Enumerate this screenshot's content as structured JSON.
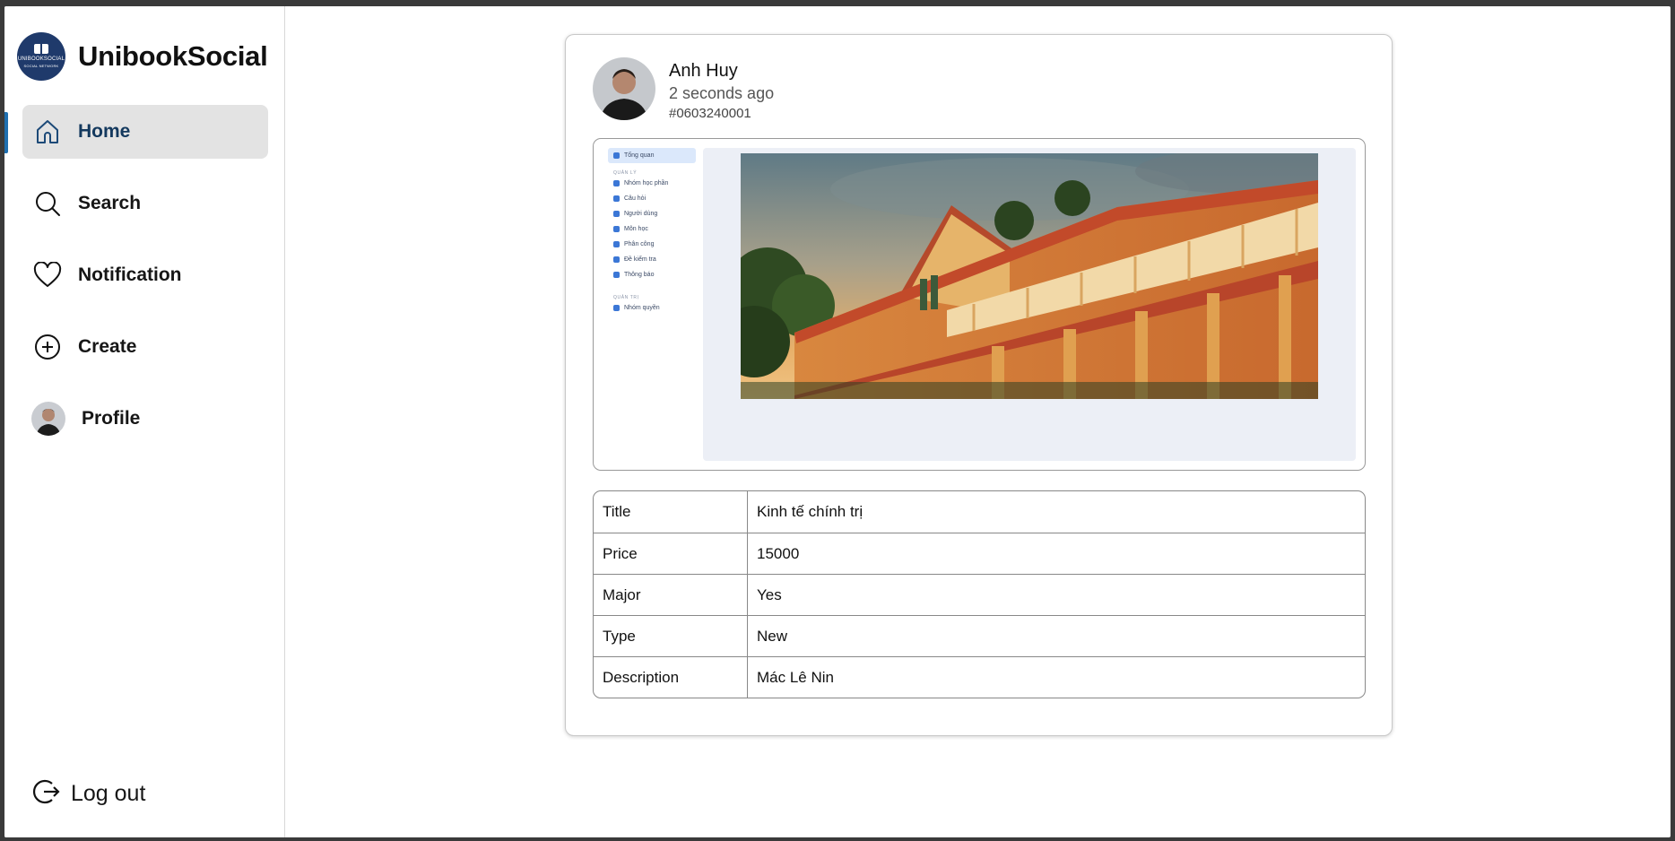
{
  "app": {
    "brand_name": "UnibookSocial",
    "logo_text": "UNIBOOKSOCIAL",
    "logo_subtext": "SOCIAL NETWORK"
  },
  "sidebar": {
    "items": [
      {
        "label": "Home",
        "icon": "home-icon",
        "active": true
      },
      {
        "label": "Search",
        "icon": "search-icon",
        "active": false
      },
      {
        "label": "Notification",
        "icon": "heart-icon",
        "active": false
      },
      {
        "label": "Create",
        "icon": "plus-circle-icon",
        "active": false
      },
      {
        "label": "Profile",
        "icon": "avatar",
        "active": false
      }
    ],
    "logout_label": "Log out"
  },
  "post": {
    "author_name": "Anh Huy",
    "time": "2 seconds ago",
    "id": "#0603240001",
    "screenshot_nav": {
      "items_top": [
        {
          "label": "Tổng quan",
          "selected": true
        }
      ],
      "section_manage": "QUẢN LÝ",
      "items_manage": [
        "Nhóm học phần",
        "Câu hỏi",
        "Người dùng",
        "Môn học",
        "Phân công",
        "Đề kiểm tra",
        "Thông báo"
      ],
      "section_admin": "QUẢN TRỊ",
      "items_admin": [
        "Nhóm quyền"
      ]
    },
    "details": [
      {
        "key": "Title",
        "value": "Kinh tế chính trị"
      },
      {
        "key": "Price",
        "value": "15000"
      },
      {
        "key": "Major",
        "value": "Yes"
      },
      {
        "key": "Type",
        "value": "New"
      },
      {
        "key": "Description",
        "value": "Mác Lê Nin"
      }
    ]
  },
  "colors": {
    "accent": "#1e6fb0",
    "active_bg": "#e3e3e3",
    "logo_bg": "#1f3a6b"
  }
}
